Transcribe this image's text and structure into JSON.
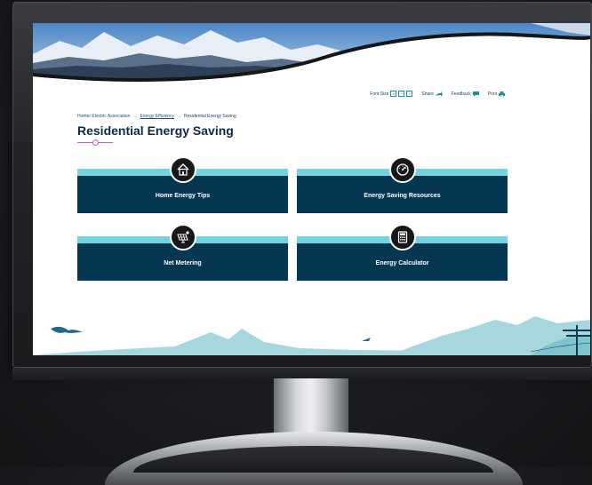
{
  "toolbar": {
    "font_size_label": "Font Size",
    "font_size_icon": "text-size-icon",
    "share_label": "Share",
    "share_icon": "share-arrow-icon",
    "feedback_label": "Feedback",
    "feedback_icon": "chat-icon",
    "print_label": "Print",
    "print_icon": "printer-icon"
  },
  "breadcrumb": {
    "items": [
      "Homer Electric Association",
      "Energy Efficiency",
      "Residential Energy Saving"
    ],
    "separator": "→"
  },
  "page": {
    "title": "Residential Energy Saving"
  },
  "cards": [
    {
      "label": "Home Energy Tips",
      "icon": "house-icon"
    },
    {
      "label": "Energy Saving Resources",
      "icon": "gauge-icon"
    },
    {
      "label": "Net Metering",
      "icon": "solar-panel-icon"
    },
    {
      "label": "Energy Calculator",
      "icon": "calculator-icon"
    }
  ],
  "colors": {
    "navy": "#053752",
    "teal": "#72d4de",
    "accent_pink": "#c05fc3"
  }
}
